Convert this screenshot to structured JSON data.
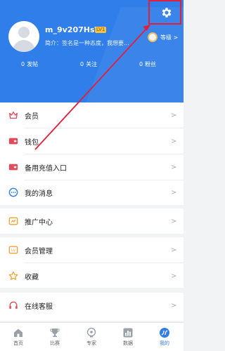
{
  "profile": {
    "username": "m_9v207HsT",
    "badge": "LV1",
    "bio": "简介：签名是一种态度，我想要...",
    "level_label": "等级 >"
  },
  "stats": [
    {
      "value": "0",
      "label": "发帖"
    },
    {
      "value": "0",
      "label": "关注"
    },
    {
      "value": "0",
      "label": "粉丝"
    }
  ],
  "menu": {
    "group1": [
      {
        "label": "会员",
        "chevron": ">"
      },
      {
        "label": "钱包",
        "chevron": ">"
      },
      {
        "label": "备用充值入口",
        "chevron": ">"
      },
      {
        "label": "我的消息",
        "chevron": ">"
      }
    ],
    "group2": [
      {
        "label": "推广中心",
        "chevron": ">"
      }
    ],
    "group3": [
      {
        "label": "会员管理",
        "chevron": ">"
      },
      {
        "label": "收藏",
        "chevron": ">"
      }
    ],
    "group4": [
      {
        "label": "在线客服",
        "chevron": ">"
      }
    ]
  },
  "tabs": [
    {
      "label": "首页"
    },
    {
      "label": "比赛"
    },
    {
      "label": "专家"
    },
    {
      "label": "数据"
    },
    {
      "label": "我的"
    }
  ],
  "colors": {
    "header": "#2f7ee9",
    "annotation": "#e0203a"
  }
}
